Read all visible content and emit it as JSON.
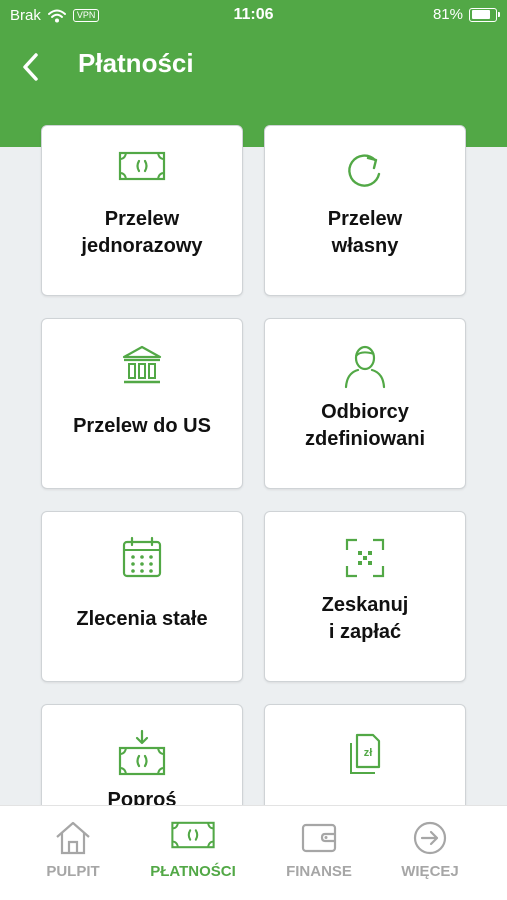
{
  "status_bar": {
    "carrier": "Brak",
    "vpn": "VPN",
    "time": "11:06",
    "battery": "81%",
    "battery_level": 0.81
  },
  "header": {
    "title": "Płatności",
    "back_icon": "chevron-left-icon"
  },
  "tiles": [
    {
      "label": "Przelew\njednorazowy",
      "icon": "banknote-icon"
    },
    {
      "label": "Przelew\nwłasny",
      "icon": "refresh-icon"
    },
    {
      "label": "Przelew do US",
      "icon": "bank-icon"
    },
    {
      "label": "Odbiorcy\nzdefiniowani",
      "icon": "user-icon"
    },
    {
      "label": "Zlecenia stałe",
      "icon": "calendar-icon"
    },
    {
      "label": "Zeskanuj\ni zapłać",
      "icon": "scan-icon"
    },
    {
      "label": "Poproś",
      "icon": "request-money-icon"
    },
    {
      "label": "",
      "icon": "documents-zl-icon"
    }
  ],
  "tabbar": {
    "tabs": [
      {
        "label": "PULPIT",
        "icon": "home-icon",
        "active": false
      },
      {
        "label": "PŁATNOŚCI",
        "icon": "banknote-icon",
        "active": true
      },
      {
        "label": "FINANSE",
        "icon": "wallet-icon",
        "active": false
      },
      {
        "label": "WIĘCEJ",
        "icon": "arrow-circle-icon",
        "active": false
      }
    ]
  },
  "colors": {
    "brand_green": "#52a846",
    "background": "#eceff1",
    "inactive_gray": "#a6a6a6"
  }
}
